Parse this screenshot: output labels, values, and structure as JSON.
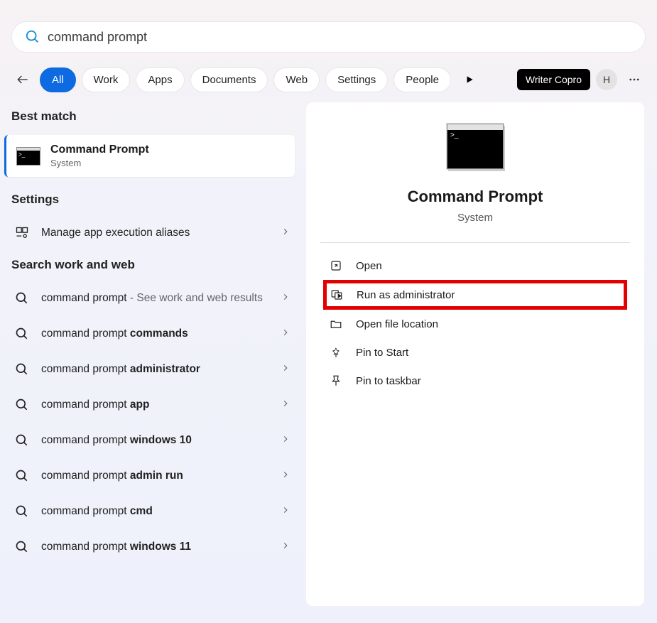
{
  "search": {
    "value": "command prompt"
  },
  "filters": {
    "items": [
      "All",
      "Work",
      "Apps",
      "Documents",
      "Web",
      "Settings",
      "People"
    ],
    "active_index": 0
  },
  "toolbar": {
    "badge": "Writer Copro",
    "avatar_initial": "H"
  },
  "left": {
    "best_match_header": "Best match",
    "best_match": {
      "title": "Command Prompt",
      "subtitle": "System"
    },
    "settings_header": "Settings",
    "settings_items": [
      {
        "icon": "aliases",
        "label": "Manage app execution aliases"
      }
    ],
    "search_header": "Search work and web",
    "suggestions": [
      {
        "prefix": "command prompt",
        "bold": "",
        "suffix": " - See work and web results"
      },
      {
        "prefix": "command prompt ",
        "bold": "commands",
        "suffix": ""
      },
      {
        "prefix": "command prompt ",
        "bold": "administrator",
        "suffix": ""
      },
      {
        "prefix": "command prompt ",
        "bold": "app",
        "suffix": ""
      },
      {
        "prefix": "command prompt ",
        "bold": "windows 10",
        "suffix": ""
      },
      {
        "prefix": "command prompt ",
        "bold": "admin run",
        "suffix": ""
      },
      {
        "prefix": "command prompt ",
        "bold": "cmd",
        "suffix": ""
      },
      {
        "prefix": "command prompt ",
        "bold": "windows 11",
        "suffix": ""
      }
    ]
  },
  "right": {
    "title": "Command Prompt",
    "subtitle": "System",
    "actions": [
      {
        "icon": "open",
        "label": "Open",
        "highlight": false
      },
      {
        "icon": "admin",
        "label": "Run as administrator",
        "highlight": true
      },
      {
        "icon": "folder",
        "label": "Open file location",
        "highlight": false
      },
      {
        "icon": "pinstart",
        "label": "Pin to Start",
        "highlight": false
      },
      {
        "icon": "pintask",
        "label": "Pin to taskbar",
        "highlight": false
      }
    ]
  }
}
